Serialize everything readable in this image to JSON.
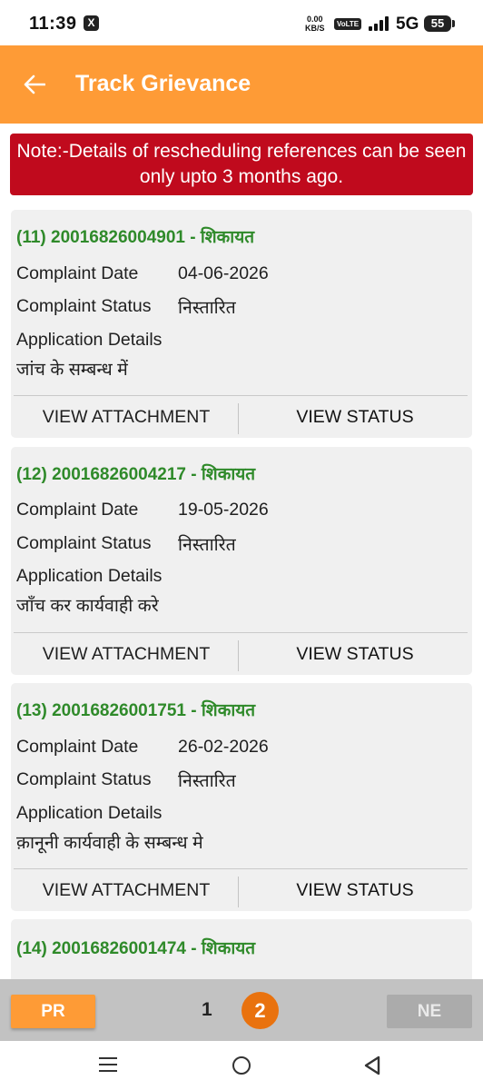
{
  "status_bar": {
    "time": "11:39",
    "app_icon": "X",
    "speed_value": "0.00",
    "speed_unit": "KB/S",
    "volte": "VoLTE",
    "network": "5G",
    "battery": "55"
  },
  "app_bar": {
    "title": "Track Grievance",
    "background_color": "#fe9b36"
  },
  "note": {
    "text": "Note:-Details of rescheduling references can be seen only upto 3 months ago.",
    "background_color": "#c00a1d"
  },
  "labels": {
    "complaint_date": "Complaint Date",
    "complaint_status": "Complaint Status",
    "application_details": "Application Details",
    "view_attachment": "VIEW ATTACHMENT",
    "view_status": "VIEW STATUS"
  },
  "grievances": [
    {
      "title": "(11) 20016826004901 - शिकायत",
      "date": "04-06-2026",
      "status": "निस्तारित",
      "details": "जांच के सम्बन्ध में"
    },
    {
      "title": "(12) 20016826004217 - शिकायत",
      "date": "19-05-2026",
      "status": "निस्तारित",
      "details": "जाँच कर कार्यवाही करे"
    },
    {
      "title": "(13) 20016826001751 - शिकायत",
      "date": "26-02-2026",
      "status": "निस्तारित",
      "details": "क़ानूनी कार्यवाही के सम्बन्ध मे"
    },
    {
      "title": "(14) 20016826001474 - शिकायत"
    }
  ],
  "pagination": {
    "prev_label": "PR",
    "next_label": "NE",
    "pages": [
      "1",
      "2"
    ],
    "current_page": "2"
  }
}
